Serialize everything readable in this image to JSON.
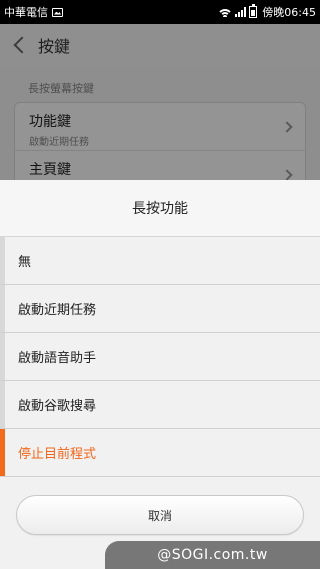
{
  "status_bar": {
    "carrier": "中華電信",
    "time": "傍晚06:45",
    "icons": [
      "image-icon",
      "wifi-icon",
      "signal-icon",
      "battery-icon"
    ]
  },
  "app_bar": {
    "title": "按鍵",
    "back_icon": "chevron-left-icon"
  },
  "content": {
    "section_label": "長按螢幕按鍵",
    "items": [
      {
        "label": "功能鍵",
        "sub": "啟動近期任務"
      },
      {
        "label": "主頁鍵",
        "sub": ""
      }
    ]
  },
  "dialog": {
    "title": "長按功能",
    "options": [
      {
        "label": "無",
        "selected": false
      },
      {
        "label": "啟動近期任務",
        "selected": false
      },
      {
        "label": "啟動語音助手",
        "selected": false
      },
      {
        "label": "啟動谷歌搜尋",
        "selected": false
      },
      {
        "label": "停止目前程式",
        "selected": true
      }
    ],
    "cancel_label": "取消",
    "accent_color": "#f2661b"
  },
  "watermark": "@SOGI.com.tw"
}
